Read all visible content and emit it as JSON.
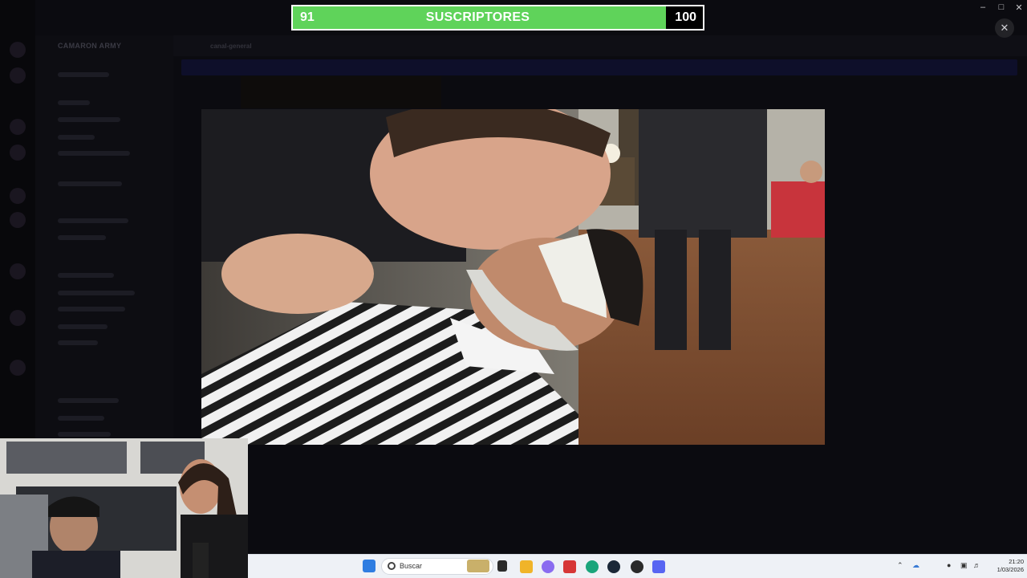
{
  "subscriber_goal": {
    "current": "91",
    "label": "SUSCRIPTORES",
    "goal": "100",
    "progress_fraction": 0.91,
    "fill_color": "#5fd35a"
  },
  "viewer": {
    "close_icon": "close-icon"
  },
  "background_app": {
    "server_name": "CAMARON ARMY",
    "channel_name": "canal-general"
  },
  "taskbar": {
    "search_placeholder": "Buscar",
    "time": "21:20",
    "date": "1/03/2026",
    "pinned_icons": [
      "start-icon",
      "search-icon",
      "file-explorer-icon",
      "folder-icon",
      "copilot-icon",
      "wps-icon",
      "edge-icon",
      "steam-icon",
      "obs-icon",
      "discord-icon"
    ],
    "tray_icons": [
      "chevron-up-icon",
      "onedrive-icon",
      "microphone-icon",
      "display-icon",
      "volume-icon"
    ]
  }
}
